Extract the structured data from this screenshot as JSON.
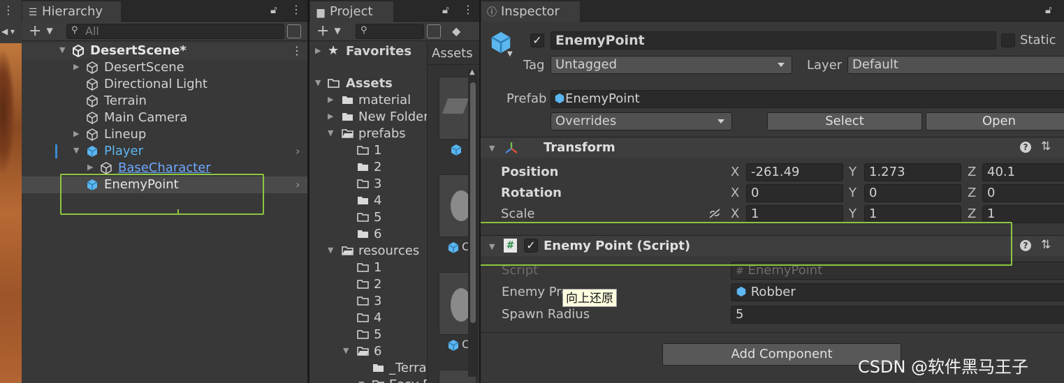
{
  "hierarchy": {
    "tab_label": "Hierarchy",
    "add_label": "+",
    "search_placeholder": "All",
    "scene_name": "DesertScene*",
    "items": [
      {
        "label": "DesertScene",
        "expandable": true,
        "link": false
      },
      {
        "label": "Directional Light",
        "expandable": false,
        "link": false
      },
      {
        "label": "Terrain",
        "expandable": false,
        "link": false
      },
      {
        "label": "Main Camera",
        "expandable": false,
        "link": false
      },
      {
        "label": "Lineup",
        "expandable": true,
        "link": false
      },
      {
        "label": "Player",
        "expandable": true,
        "link": false,
        "prefab": true
      },
      {
        "label": "BaseCharacter",
        "expandable": true,
        "link": true
      },
      {
        "label": "EnemyPoint",
        "expandable": false,
        "link": false,
        "prefab": true,
        "selected": true
      }
    ]
  },
  "project": {
    "tab_label": "Project",
    "add_label": "+",
    "favorites_label": "Favorites",
    "assets_label": "Assets",
    "assets_breadcrumb": "Assets",
    "tree": [
      {
        "label": "material",
        "kind": "folder"
      },
      {
        "label": "New Folder",
        "kind": "folder"
      },
      {
        "label": "prefabs",
        "kind": "open-folder"
      },
      {
        "label": "1",
        "kind": "empty-folder"
      },
      {
        "label": "2",
        "kind": "folder"
      },
      {
        "label": "3",
        "kind": "empty-folder"
      },
      {
        "label": "4",
        "kind": "folder"
      },
      {
        "label": "5",
        "kind": "empty-folder"
      },
      {
        "label": "6",
        "kind": "folder"
      },
      {
        "label": "resources",
        "kind": "open-folder"
      },
      {
        "label": "1",
        "kind": "empty-folder"
      },
      {
        "label": "2",
        "kind": "empty-folder"
      },
      {
        "label": "3",
        "kind": "empty-folder"
      },
      {
        "label": "4",
        "kind": "empty-folder"
      },
      {
        "label": "5",
        "kind": "empty-folder"
      },
      {
        "label": "6",
        "kind": "open-folder"
      },
      {
        "label": "_Terra",
        "kind": "folder"
      },
      {
        "label": "Easy F",
        "kind": "open-folder"
      }
    ],
    "grid_labels": [
      "C",
      "C",
      "C"
    ]
  },
  "inspector": {
    "tab_label": "Inspector",
    "object_name": "EnemyPoint",
    "static_label": "Static",
    "tag_label": "Tag",
    "tag_value": "Untagged",
    "layer_label": "Layer",
    "layer_value": "Default",
    "prefab_label": "Prefab",
    "prefab_value": "EnemyPoint",
    "overrides_label": "Overrides",
    "select_label": "Select",
    "open_label": "Open",
    "transform": {
      "title": "Transform",
      "position_label": "Position",
      "rotation_label": "Rotation",
      "scale_label": "Scale",
      "axis_x": "X",
      "axis_y": "Y",
      "axis_z": "Z",
      "position": {
        "x": "-261.49",
        "y": "1.273",
        "z": "40.1"
      },
      "rotation": {
        "x": "0",
        "y": "0",
        "z": "0"
      },
      "scale": {
        "x": "1",
        "y": "1",
        "z": "1"
      }
    },
    "script_component": {
      "title": "Enemy Point (Script)",
      "script_label": "Script",
      "script_value": "EnemyPoint",
      "enemy_prefab_label": "Enemy Pre",
      "enemy_prefab_value": "Robber",
      "spawn_radius_label": "Spawn Radius",
      "spawn_radius_value": "5"
    },
    "add_component_label": "Add Component"
  },
  "tooltip": "向上还原",
  "watermark": "CSDN @软件黑马王子",
  "colors": {
    "accent_green": "#8cc63f",
    "prefab_blue": "#5cb6f0",
    "link_blue": "#6ea8ff"
  }
}
